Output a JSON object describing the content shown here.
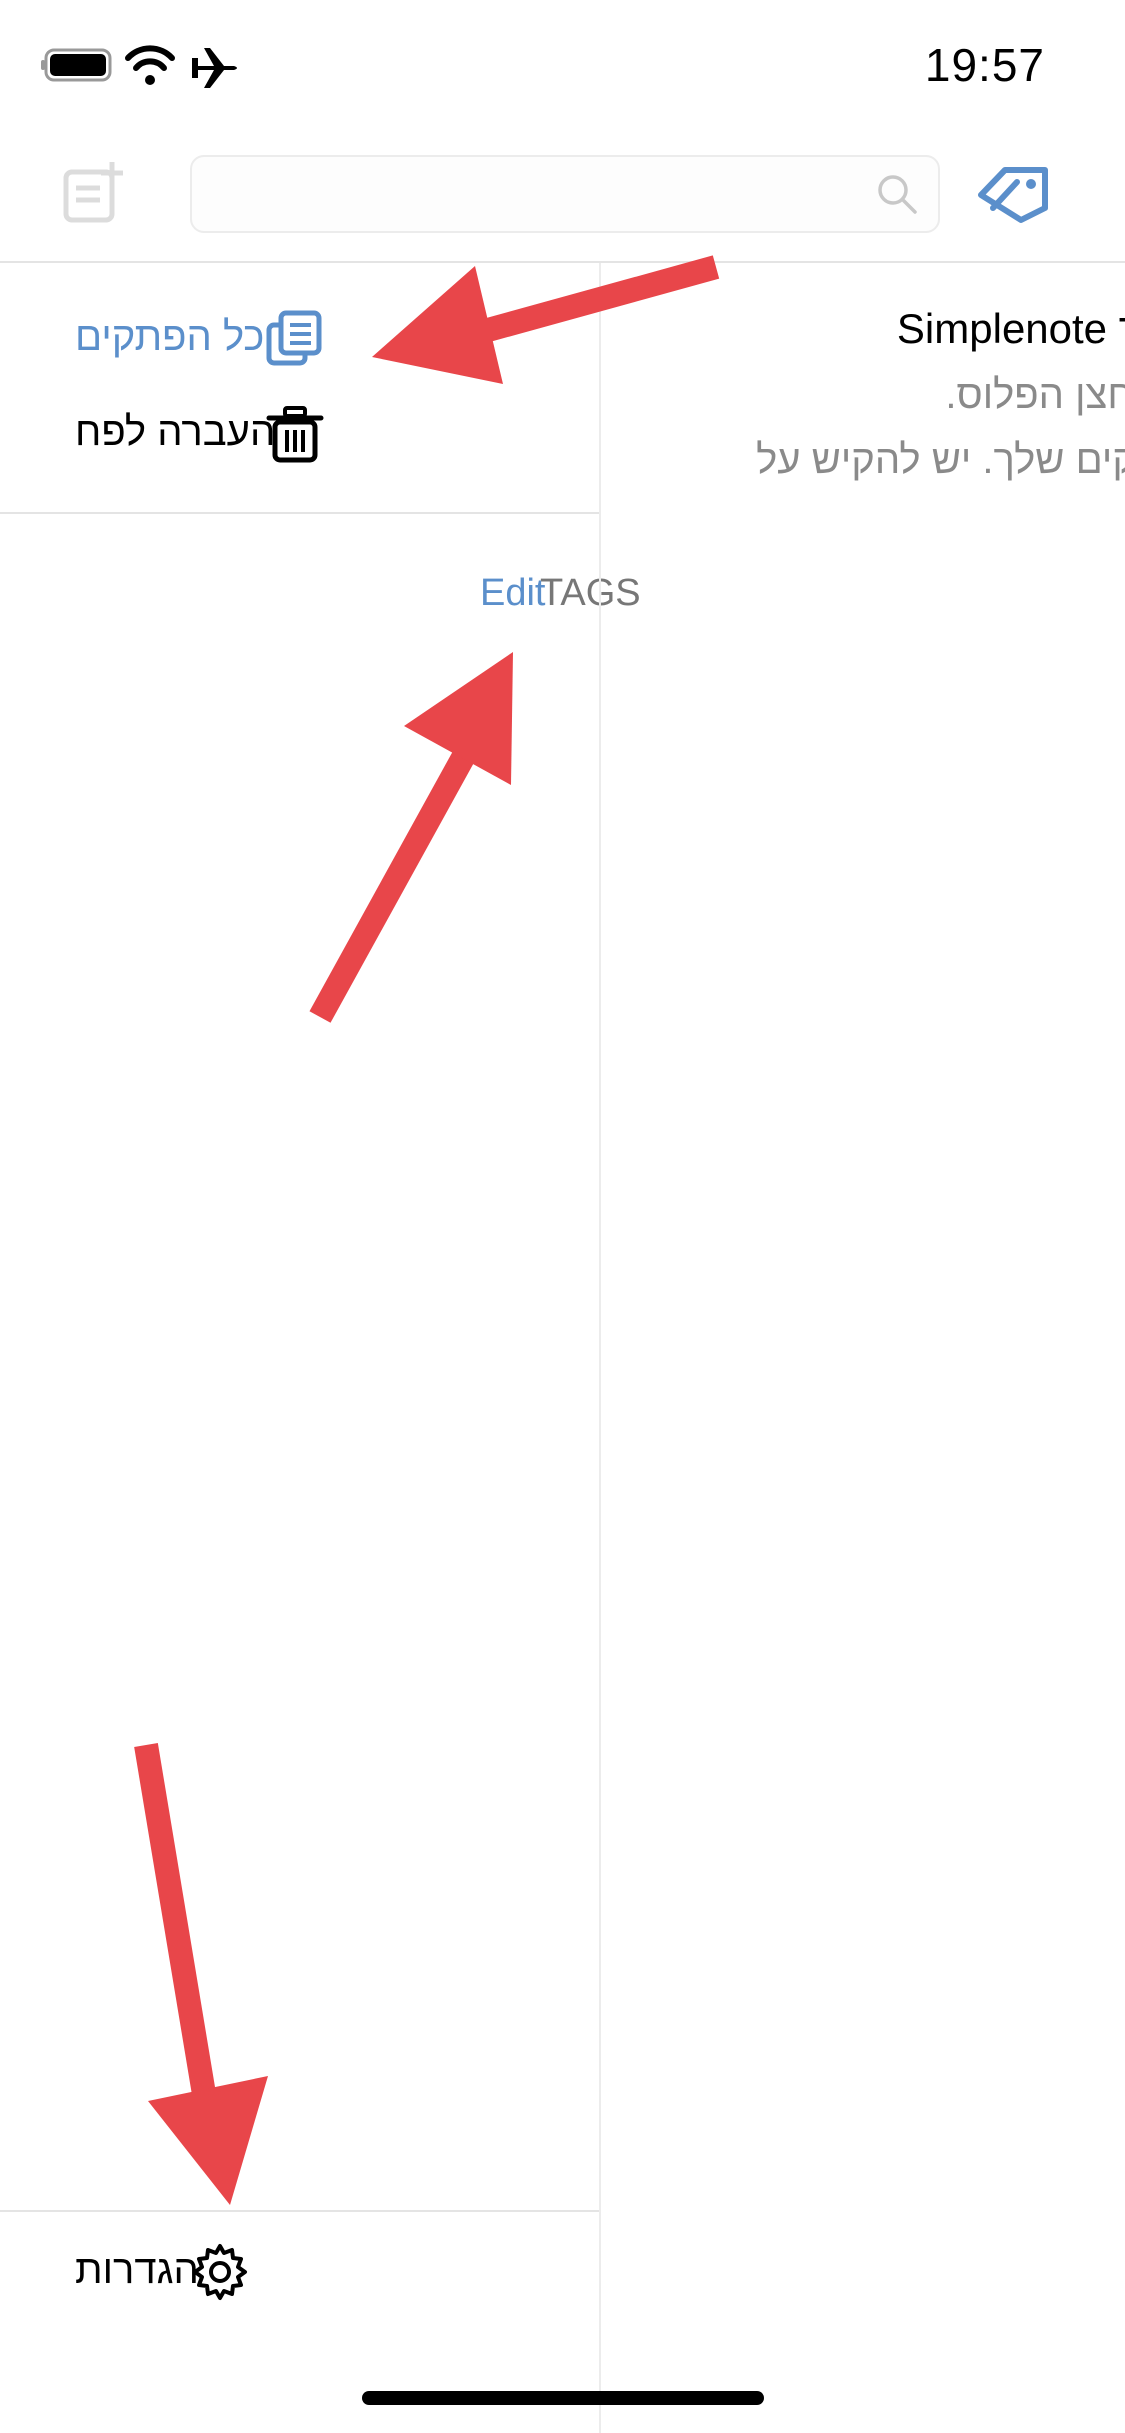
{
  "status_bar": {
    "time": "19:57"
  },
  "search": {
    "placeholder": ""
  },
  "sidebar": {
    "items": [
      {
        "label": "כל הפתקים",
        "icon": "notes-icon",
        "color": "#5b8fcb"
      },
      {
        "label": "העברה לפח",
        "icon": "trash-icon",
        "color": "#000000"
      }
    ],
    "tags_header": "TAGS",
    "edit_label": "Edit",
    "settings_label": "הגדרות"
  },
  "content": {
    "title": "Simplenote עבור iOS!",
    "lines": [
      "לחיצה על לחצן הפלוס.",
      "כל הפתקים שלך. יש להקיש על"
    ]
  },
  "colors": {
    "accent": "#5b8fcb",
    "annotation": "#e8464a"
  }
}
